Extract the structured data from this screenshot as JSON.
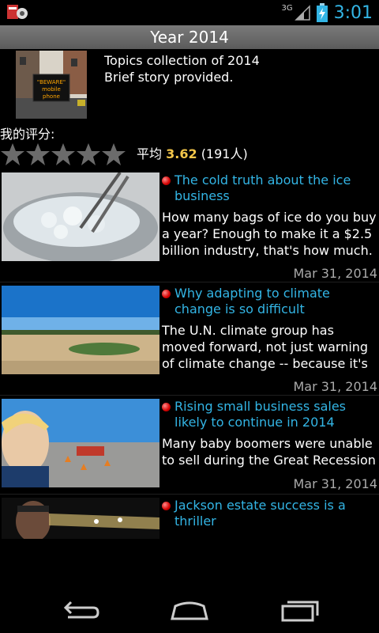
{
  "status": {
    "network": "3G",
    "time": "3:01"
  },
  "title": "Year 2014",
  "topic": {
    "line1": "Topics collection of 2014",
    "line2": "Brief story provided.",
    "thumb_sign": "\"BEWARE\" mobile phone"
  },
  "rating": {
    "label": "我的评分:",
    "my_stars": 0,
    "avg_label": "平均",
    "avg_value": "3.62",
    "count": "(191人)"
  },
  "articles": [
    {
      "title": "The cold truth about the ice business",
      "summary": "How many bags of ice do you buy a year? Enough to make it a $2.5 billion industry, that's how much.",
      "date": "Mar 31, 2014"
    },
    {
      "title": "Why adapting to climate change is so difficult",
      "summary": "The U.N. climate group has moved forward, not just warning of climate change -- because it's",
      "date": "Mar 31, 2014"
    },
    {
      "title": "Rising small business sales likely to continue in 2014",
      "summary": "Many baby boomers were unable to sell during the Great Recession",
      "date": "Mar 31, 2014"
    },
    {
      "title": "Jackson estate success is a thriller",
      "summary": "",
      "date": ""
    }
  ],
  "colors": {
    "accent": "#33b5e5",
    "score": "#f3c64a",
    "title_bar": "#6b6b6b"
  },
  "icons": {
    "back": "back-icon",
    "home": "home-icon",
    "recents": "recents-icon"
  }
}
